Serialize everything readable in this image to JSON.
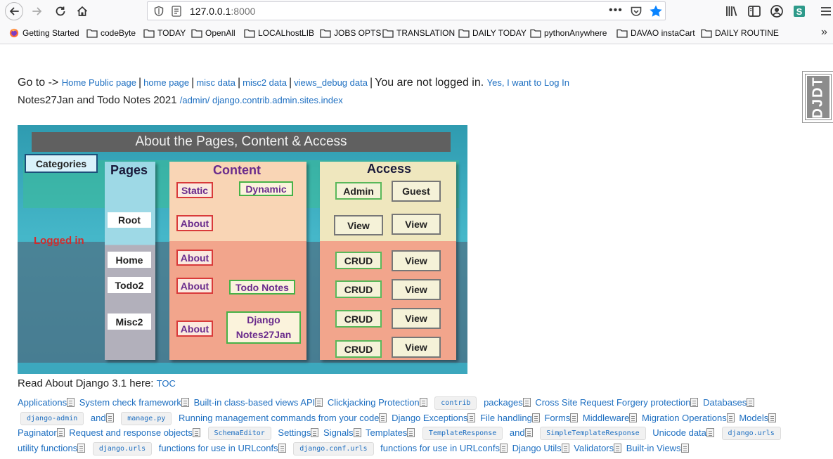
{
  "browser": {
    "url_host": "127.0.0.1",
    "url_port": ":8000",
    "more_label": "•••",
    "bookmarks": [
      {
        "label": "Getting Started",
        "icon": "firefox-icon"
      },
      {
        "label": "codeByte",
        "icon": "folder-icon"
      },
      {
        "label": "TODAY",
        "icon": "folder-icon"
      },
      {
        "label": "OpenAll",
        "icon": "folder-icon"
      },
      {
        "label": "LOCALhostLIB",
        "icon": "folder-icon"
      },
      {
        "label": "JOBS OPTS",
        "icon": "folder-icon"
      },
      {
        "label": "TRANSLATION",
        "icon": "folder-icon"
      },
      {
        "label": "DAILY TODAY",
        "icon": "folder-icon"
      },
      {
        "label": "pythonAnywhere",
        "icon": "folder-icon"
      },
      {
        "label": "DAVAO instaCart",
        "icon": "folder-icon"
      },
      {
        "label": "DAILY ROUTINE",
        "icon": "folder-icon"
      }
    ],
    "bookmarks_overflow": "»",
    "colors": {
      "star": "#0a84ff",
      "link": "#1e6fc1",
      "ext": "#2e9a8a"
    }
  },
  "page": {
    "goto_prefix": "Go to ->",
    "nav_links": [
      "Home Public page",
      "home page",
      "misc data",
      "misc2 data",
      "views_debug data"
    ],
    "separator": "|",
    "not_logged_in": "You are not logged in.",
    "login_link": "Yes, I want to Log In",
    "subtitle": "Notes27Jan and Todo Notes 2021",
    "admin_link": "/admin/ django.contrib.admin.sites.index",
    "djdt_label": "DJDT",
    "read_about": "Read About Django 3.1 here:",
    "toc_link": "TOC"
  },
  "diagram": {
    "title": "About the Pages, Content & Access",
    "categories": "Categories",
    "logged_in": "Logged in",
    "pages_head": "Pages",
    "content_head": "Content",
    "access_head": "Access",
    "pages": [
      "Root",
      "Home",
      "Todo2",
      "Misc2"
    ],
    "content": {
      "static": "Static",
      "dynamic": "Dynamic",
      "about": "About",
      "todo_notes": "Todo Notes",
      "django_notes": "Django Notes27Jan"
    },
    "access": {
      "admin": "Admin",
      "guest": "Guest",
      "view": "View",
      "crud": "CRUD"
    }
  },
  "docs": {
    "items": [
      {
        "t": "link",
        "v": "Applications"
      },
      {
        "t": "link",
        "v": "System check framework"
      },
      {
        "t": "link",
        "v": "Built-in class-based views API"
      },
      {
        "t": "link",
        "v": "Clickjacking Protection"
      },
      {
        "t": "code",
        "v": "contrib"
      },
      {
        "t": "text",
        "v": "packages"
      },
      {
        "t": "link",
        "v": "Cross Site Request Forgery protection"
      },
      {
        "t": "link",
        "v": "Databases"
      },
      {
        "t": "code",
        "v": "django-admin"
      },
      {
        "t": "text",
        "v": "and"
      },
      {
        "t": "code",
        "v": "manage.py"
      },
      {
        "t": "link",
        "v": "Running management commands from your code"
      },
      {
        "t": "link",
        "v": "Django Exceptions"
      },
      {
        "t": "link",
        "v": "File handling"
      },
      {
        "t": "link",
        "v": "Forms"
      },
      {
        "t": "link",
        "v": "Middleware"
      },
      {
        "t": "link",
        "v": "Migration Operations"
      },
      {
        "t": "link",
        "v": "Models"
      },
      {
        "t": "link",
        "v": "Paginator"
      },
      {
        "t": "link",
        "v": "Request and response objects"
      },
      {
        "t": "code",
        "v": "SchemaEditor"
      },
      {
        "t": "link",
        "v": "Settings"
      },
      {
        "t": "link",
        "v": "Signals"
      },
      {
        "t": "link",
        "v": "Templates"
      },
      {
        "t": "code",
        "v": "TemplateResponse"
      },
      {
        "t": "text",
        "v": "and"
      },
      {
        "t": "code",
        "v": "SimpleTemplateResponse"
      },
      {
        "t": "link",
        "v": "Unicode data"
      },
      {
        "t": "code",
        "v": "django.urls"
      },
      {
        "t": "text",
        "v": "utility functions"
      },
      {
        "t": "code",
        "v": "django.urls"
      },
      {
        "t": "text",
        "v": "functions for use in URLconfs"
      },
      {
        "t": "code",
        "v": "django.conf.urls"
      },
      {
        "t": "text",
        "v": "functions for use in URLconfs"
      },
      {
        "t": "link",
        "v": "Django Utils"
      },
      {
        "t": "link",
        "v": "Validators"
      },
      {
        "t": "link",
        "v": "Built-in Views"
      }
    ]
  }
}
